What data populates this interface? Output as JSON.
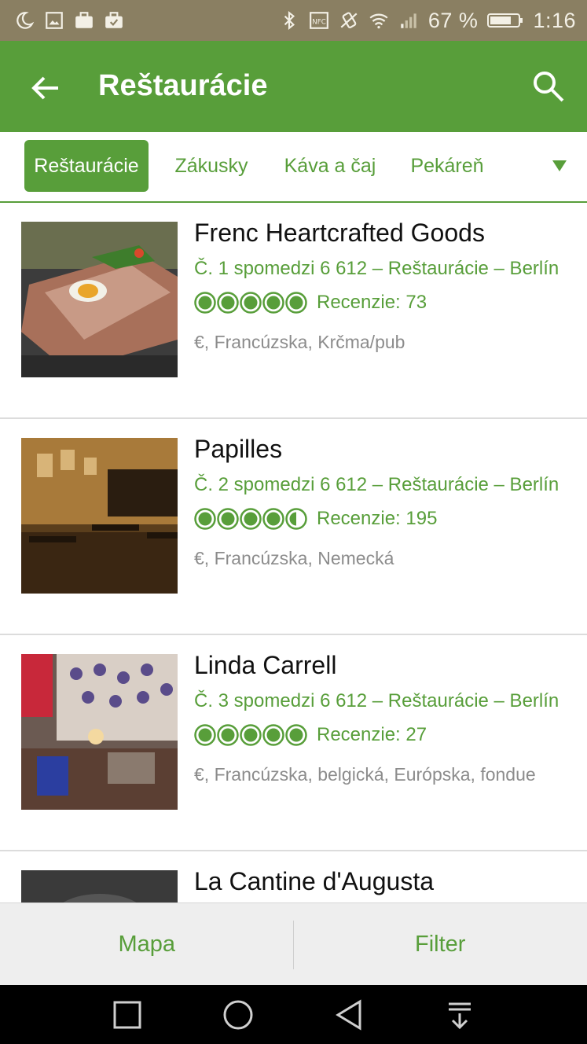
{
  "status_bar": {
    "battery_percent": "67 %",
    "time": "1:16",
    "icons_left": [
      "moon-icon",
      "image-icon",
      "briefcase-icon",
      "briefcase-check-icon"
    ],
    "icons_right": [
      "bluetooth-icon",
      "nfc-icon",
      "vibrate-icon",
      "wifi-icon",
      "signal-icon",
      "battery-icon"
    ]
  },
  "app_bar": {
    "title": "Reštaurácie",
    "back_icon": "arrow-left-icon",
    "search_icon": "search-icon",
    "color": "#589e3a"
  },
  "tabs": {
    "items": [
      {
        "label": "Reštaurácie",
        "active": true
      },
      {
        "label": "Zákusky",
        "active": false
      },
      {
        "label": "Káva a čaj",
        "active": false
      },
      {
        "label": "Pekáreň",
        "active": false
      }
    ],
    "more_icon": "triangle-down-icon"
  },
  "restaurants": [
    {
      "name": "Frenc Heartcrafted Goods",
      "rank": "Č. 1 spomedzi 6 612 – Reštaurácie – Berlín",
      "rating": 5,
      "reviews": "Recenzie: 73",
      "tags": "€, Francúzska, Krčma/pub"
    },
    {
      "name": "Papilles",
      "rank": "Č. 2 spomedzi 6 612 – Reštaurácie – Berlín",
      "rating": 4.5,
      "reviews": "Recenzie: 195",
      "tags": "€, Francúzska, Nemecká"
    },
    {
      "name": "Linda Carrell",
      "rank": "Č. 3 spomedzi 6 612 – Reštaurácie – Berlín",
      "rating": 5,
      "reviews": "Recenzie: 27",
      "tags": "€, Francúzska, belgická, Európska, fondue"
    },
    {
      "name": "La Cantine d'Augusta",
      "rank": "",
      "rating": null,
      "reviews": "",
      "tags": ""
    }
  ],
  "bottom_bar": {
    "map_label": "Mapa",
    "filter_label": "Filter"
  },
  "nav_bar": {
    "icons": [
      "square-icon",
      "circle-icon",
      "triangle-back-icon",
      "notification-pull-icon"
    ]
  }
}
